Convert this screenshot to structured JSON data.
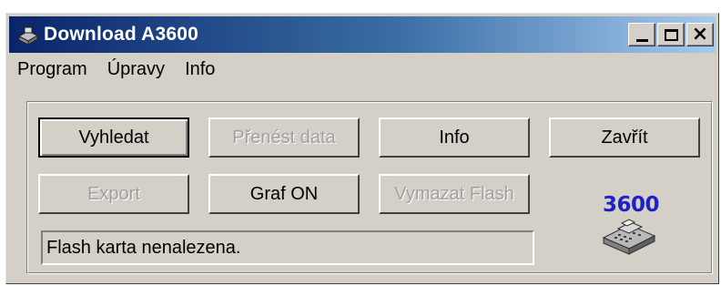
{
  "window": {
    "title": "Download A3600",
    "controls": {
      "minimize": "_",
      "maximize": "□",
      "close": "×"
    }
  },
  "menu": {
    "items": [
      {
        "label": "Program",
        "mnemonic": "P"
      },
      {
        "label": "Úpravy",
        "mnemonic": "a"
      },
      {
        "label": "Info",
        "mnemonic": "I"
      }
    ]
  },
  "buttons": {
    "search": "Vyhledat",
    "transfer": "Přenést data",
    "info": "Info",
    "close": "Zavřít",
    "export": "Export",
    "graph": "Graf ON",
    "erase_flash": "Vymazat Flash"
  },
  "status": {
    "message": "Flash karta nenalezena."
  },
  "device": {
    "label": "3600",
    "icon": "cash-register-icon"
  },
  "colors": {
    "title_gradient_start": "#0a246a",
    "title_gradient_end": "#a6caf0",
    "face": "#d4d0c8",
    "device_label": "#2020c8",
    "disabled_text": "#a0a0a0"
  }
}
